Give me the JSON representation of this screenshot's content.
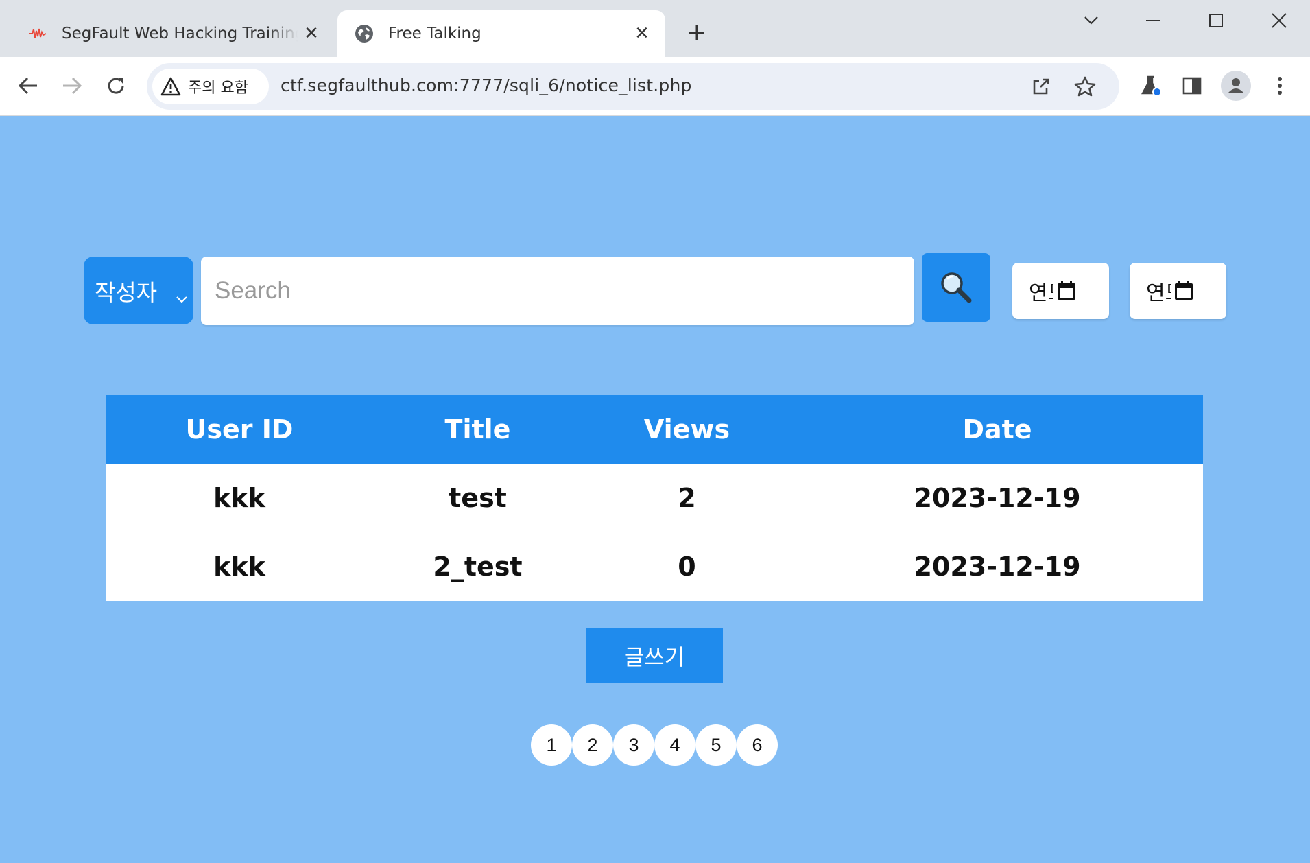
{
  "browser": {
    "tabs": [
      {
        "title": "SegFault Web Hacking Training",
        "active": false,
        "icon": "segfault-favicon"
      },
      {
        "title": "Free Talking",
        "active": true,
        "icon": "globe-icon"
      }
    ],
    "security_label": "주의 요함",
    "url": "ctf.segfaulthub.com:7777/sqli_6/notice_list.php"
  },
  "search": {
    "field_selected": "작성자",
    "placeholder": "Search",
    "value": "",
    "date_from_text": "연도",
    "date_to_text": "연도"
  },
  "table": {
    "headers": [
      "User ID",
      "Title",
      "Views",
      "Date"
    ],
    "rows": [
      [
        "kkk",
        "test",
        "2",
        "2023-12-19"
      ],
      [
        "kkk",
        "2_test",
        "0",
        "2023-12-19"
      ]
    ]
  },
  "write_button": "글쓰기",
  "pagination": [
    "1",
    "2",
    "3",
    "4",
    "5",
    "6"
  ],
  "colors": {
    "page_bg": "#82bdf5",
    "accent": "#1f8bed",
    "tabbar_bg": "#dfe3e8"
  }
}
